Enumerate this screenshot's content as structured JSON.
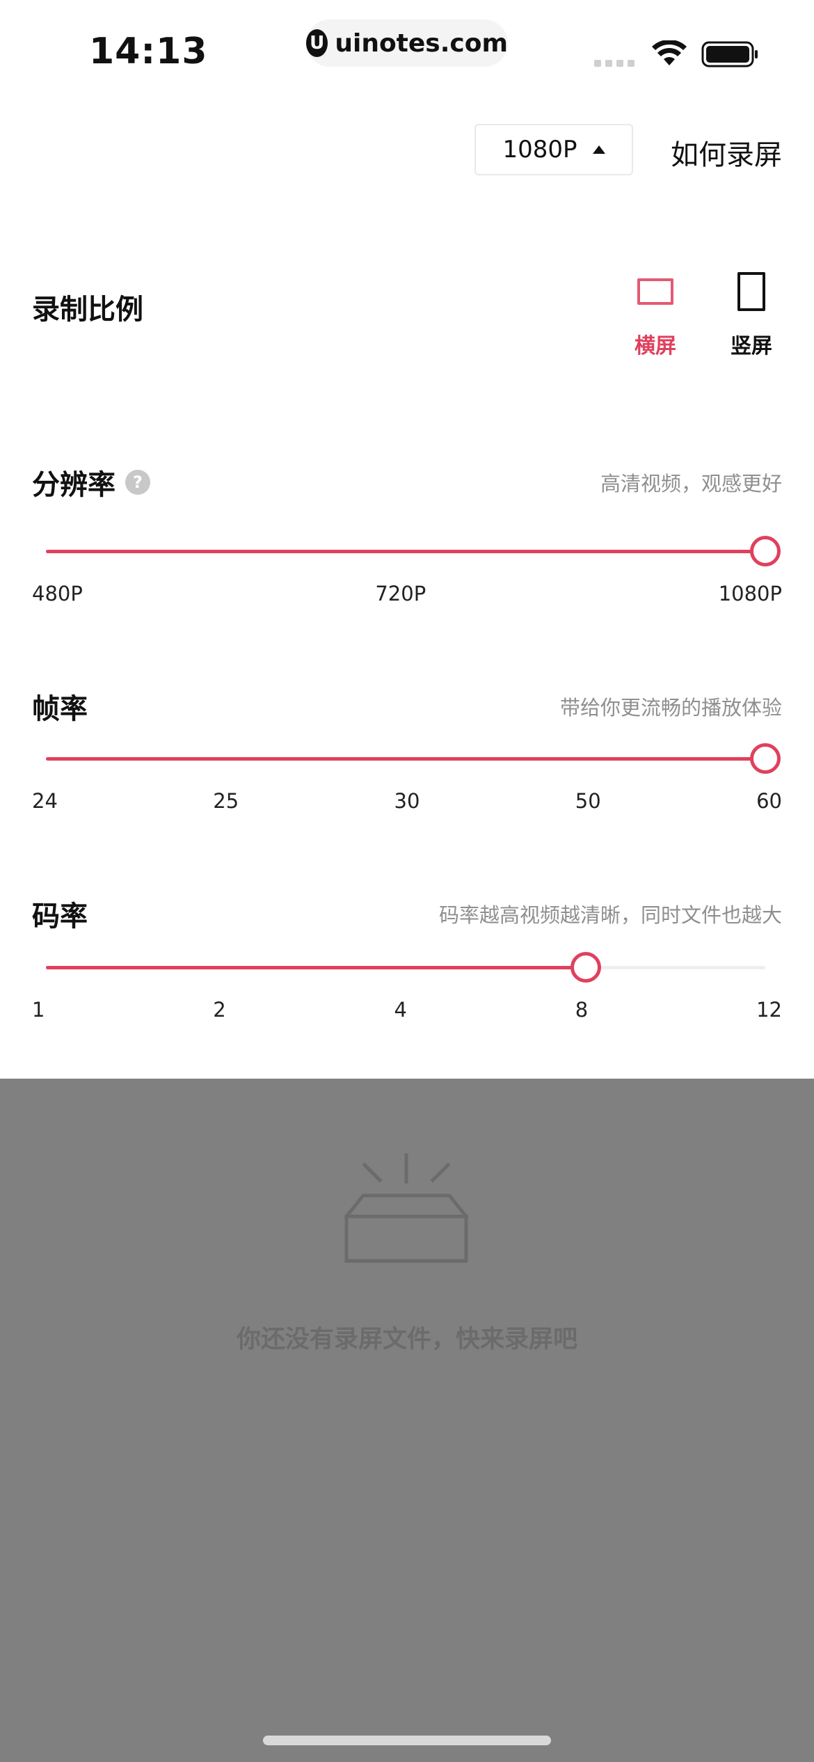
{
  "status_bar": {
    "time": "14:13",
    "url": "uinotes.com",
    "url_logo_letter": "U"
  },
  "header": {
    "resolution_dropdown": "1080P",
    "how_to_record": "如何录屏"
  },
  "ratio": {
    "title": "录制比例",
    "options": [
      {
        "label": "横屏",
        "icon": "landscape-rect-icon",
        "active": true
      },
      {
        "label": "竖屏",
        "icon": "portrait-rect-icon",
        "active": false
      }
    ]
  },
  "resolution": {
    "title": "分辨率",
    "help_icon": "?",
    "hint": "高清视频，观感更好",
    "ticks": [
      "480P",
      "720P",
      "1080P"
    ],
    "selected_index": 2
  },
  "frame_rate": {
    "title": "帧率",
    "hint": "带给你更流畅的播放体验",
    "ticks": [
      "24",
      "25",
      "30",
      "50",
      "60"
    ],
    "selected_index": 4
  },
  "bit_rate": {
    "title": "码率",
    "hint": "码率越高视频越清晰，同时文件也越大",
    "ticks": [
      "1",
      "2",
      "4",
      "8",
      "12"
    ],
    "selected_index": 3
  },
  "empty_state": {
    "icon": "empty-box-icon",
    "message": "你还没有录屏文件，快来录屏吧"
  },
  "colors": {
    "accent": "#e0405d",
    "overlay": "#808080"
  }
}
